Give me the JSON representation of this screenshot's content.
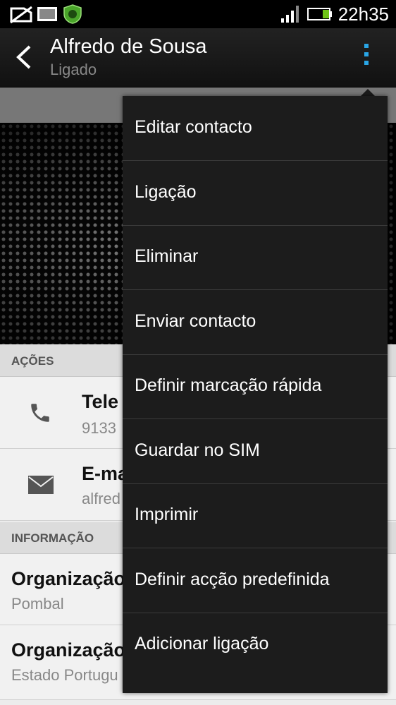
{
  "status_bar": {
    "time": "22h35"
  },
  "header": {
    "title": "Alfredo de Sousa",
    "subtitle": "Ligado"
  },
  "sections": {
    "actions": {
      "label": "AÇÕES"
    },
    "info": {
      "label": "INFORMAÇÃO"
    }
  },
  "action_rows": [
    {
      "title": "Tele",
      "subtitle": "9133"
    },
    {
      "title": "E-ma",
      "subtitle": "alfred"
    }
  ],
  "info_rows": [
    {
      "title": "Organização",
      "subtitle": "Pombal"
    },
    {
      "title": "Organização",
      "subtitle": "Estado Portugu"
    }
  ],
  "menu": {
    "items": [
      "Editar contacto",
      "Ligação",
      "Eliminar",
      "Enviar contacto",
      "Definir marcação rápida",
      "Guardar no SIM",
      "Imprimir",
      "Definir acção predefinida",
      "Adicionar ligação"
    ]
  },
  "colors": {
    "accent": "#2aa6e6",
    "battery": "#6fc417",
    "menu_bg": "#1c1c1c"
  }
}
